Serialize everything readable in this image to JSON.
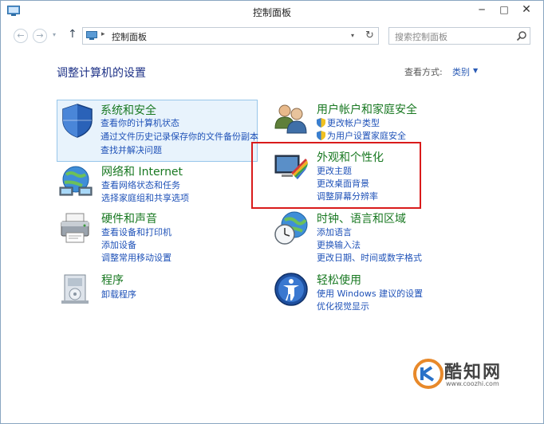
{
  "window": {
    "title": "控制面板",
    "min_glyph": "─",
    "max_glyph": "□",
    "close_glyph": "✕"
  },
  "nav": {
    "back_glyph": "←",
    "forward_glyph": "→",
    "dropdown_glyph": "▾",
    "up_glyph": "↑",
    "address_separator": "▸",
    "address_text": "控制面板",
    "address_dropdown_glyph": "▾",
    "refresh_glyph": "↻",
    "search_placeholder": "搜索控制面板"
  },
  "main": {
    "title": "调整计算机的设置",
    "view_by_label": "查看方式:",
    "view_by_value": "类别",
    "view_by_drop_glyph": "▼"
  },
  "categories": {
    "security": {
      "title": "系统和安全",
      "links": [
        "查看你的计算机状态",
        "通过文件历史记录保存你的文件备份副本",
        "查找并解决问题"
      ]
    },
    "network": {
      "title": "网络和 Internet",
      "links": [
        "查看网络状态和任务",
        "选择家庭组和共享选项"
      ]
    },
    "hardware": {
      "title": "硬件和声音",
      "links": [
        "查看设备和打印机",
        "添加设备",
        "调整常用移动设置"
      ]
    },
    "programs": {
      "title": "程序",
      "links": [
        "卸载程序"
      ]
    },
    "accounts": {
      "title": "用户帐户和家庭安全",
      "links": [
        "更改帐户类型",
        "为用户设置家庭安全"
      ]
    },
    "appearance": {
      "title": "外观和个性化",
      "links": [
        "更改主题",
        "更改桌面背景",
        "调整屏幕分辨率"
      ]
    },
    "clock": {
      "title": "时钟、语言和区域",
      "links": [
        "添加语言",
        "更换输入法",
        "更改日期、时间或数字格式"
      ]
    },
    "ease": {
      "title": "轻松使用",
      "links": [
        "使用 Windows 建议的设置",
        "优化视觉显示"
      ]
    }
  },
  "watermark": {
    "name": "酷知网",
    "url": "www.coozhi.com"
  },
  "colors": {
    "highlight_box": "#d91b1b",
    "category_title": "#187821",
    "link": "#1f52b8",
    "page_title": "#1e3287"
  }
}
